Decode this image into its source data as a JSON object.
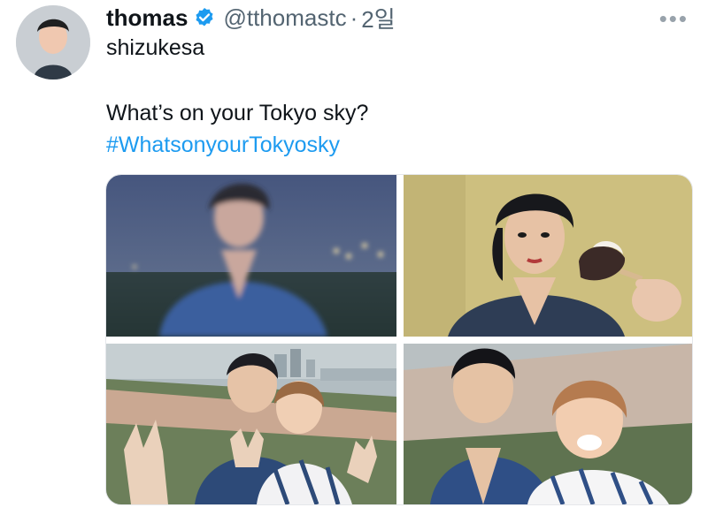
{
  "tweet": {
    "author": {
      "name": "thomas",
      "handle": "@tthomastc",
      "time": "2일",
      "verified": true,
      "avatar_icon": "avatar-photo"
    },
    "subline": "shizukesa",
    "text": "What’s on your Tokyo sky?",
    "hashtag": "#WhatsonyourTokyosky",
    "more_icon": "more-horizontal-icon",
    "colors": {
      "handle_gray": "#536471",
      "hashtag_blue": "#1d9bf0",
      "verified_blue": "#1d9bf0"
    },
    "media": [
      {
        "alt": "photo-1"
      },
      {
        "alt": "photo-2"
      },
      {
        "alt": "photo-3"
      },
      {
        "alt": "photo-4"
      }
    ]
  }
}
